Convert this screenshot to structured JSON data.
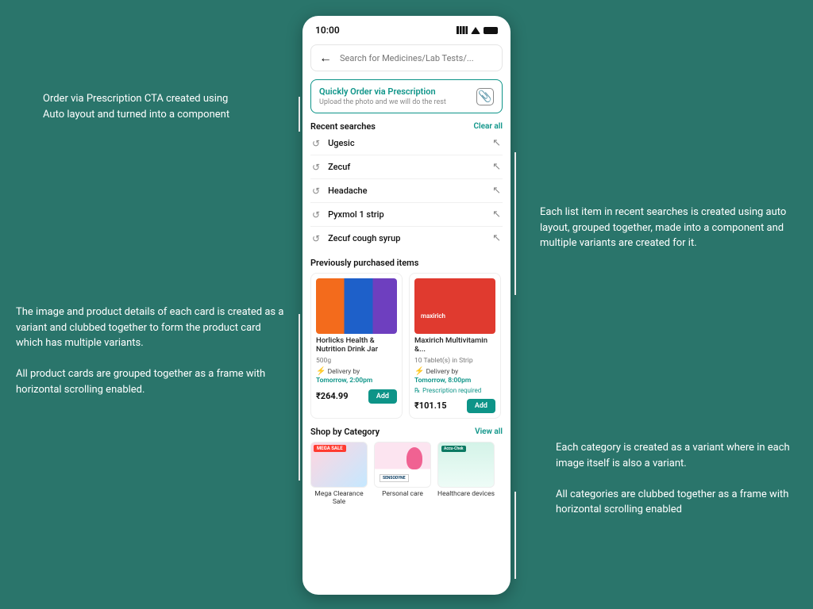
{
  "annotations": {
    "left1": "Order via Prescription CTA created using Auto layout and turned into a component",
    "left2a": "The image and product details of each card is created as a variant and clubbed together to form the product card which has multiple variants.",
    "left2b": "All product cards are grouped together as a frame with horizontal scrolling enabled.",
    "right1": "Each list item in recent searches is created using auto layout, grouped together, made into a component and multiple variants are created for it.",
    "right2a": "Each category is created as a variant where in each image itself is also a variant.",
    "right2b": "All categories are clubbed together as a frame with horizontal scrolling enabled"
  },
  "status": {
    "time": "10:00"
  },
  "search": {
    "placeholder": "Search for Medicines/Lab Tests/..."
  },
  "cta": {
    "title": "Quickly Order via Prescription",
    "sub": "Upload the photo and we will do the rest"
  },
  "recent": {
    "title": "Recent searches",
    "clear": "Clear all",
    "items": [
      "Ugesic",
      "Zecuf",
      "Headache",
      "Pyxmol 1 strip",
      "Zecuf cough syrup"
    ]
  },
  "prev": {
    "title": "Previously purchased items",
    "items": [
      {
        "name": "Horlicks Health & Nutrition Drink Jar",
        "sub": "500g",
        "delivery": "Delivery by",
        "when": "Tomorrow, 2:00pm",
        "price": "₹264.99",
        "add": "Add"
      },
      {
        "name": "Maxirich Multivitamin &...",
        "sub": "10 Tablet(s) in Strip",
        "delivery": "Delivery by",
        "when": "Tomorrow, 8:00pm",
        "presc": "Prescription required",
        "price": "₹101.15",
        "add": "Add"
      }
    ]
  },
  "cat": {
    "title": "Shop by Category",
    "view": "View all",
    "items": [
      {
        "label": "Mega Clearance Sale",
        "badge": "MEGA SALE"
      },
      {
        "label": "Personal care"
      },
      {
        "label": "Healthcare devices"
      }
    ]
  }
}
